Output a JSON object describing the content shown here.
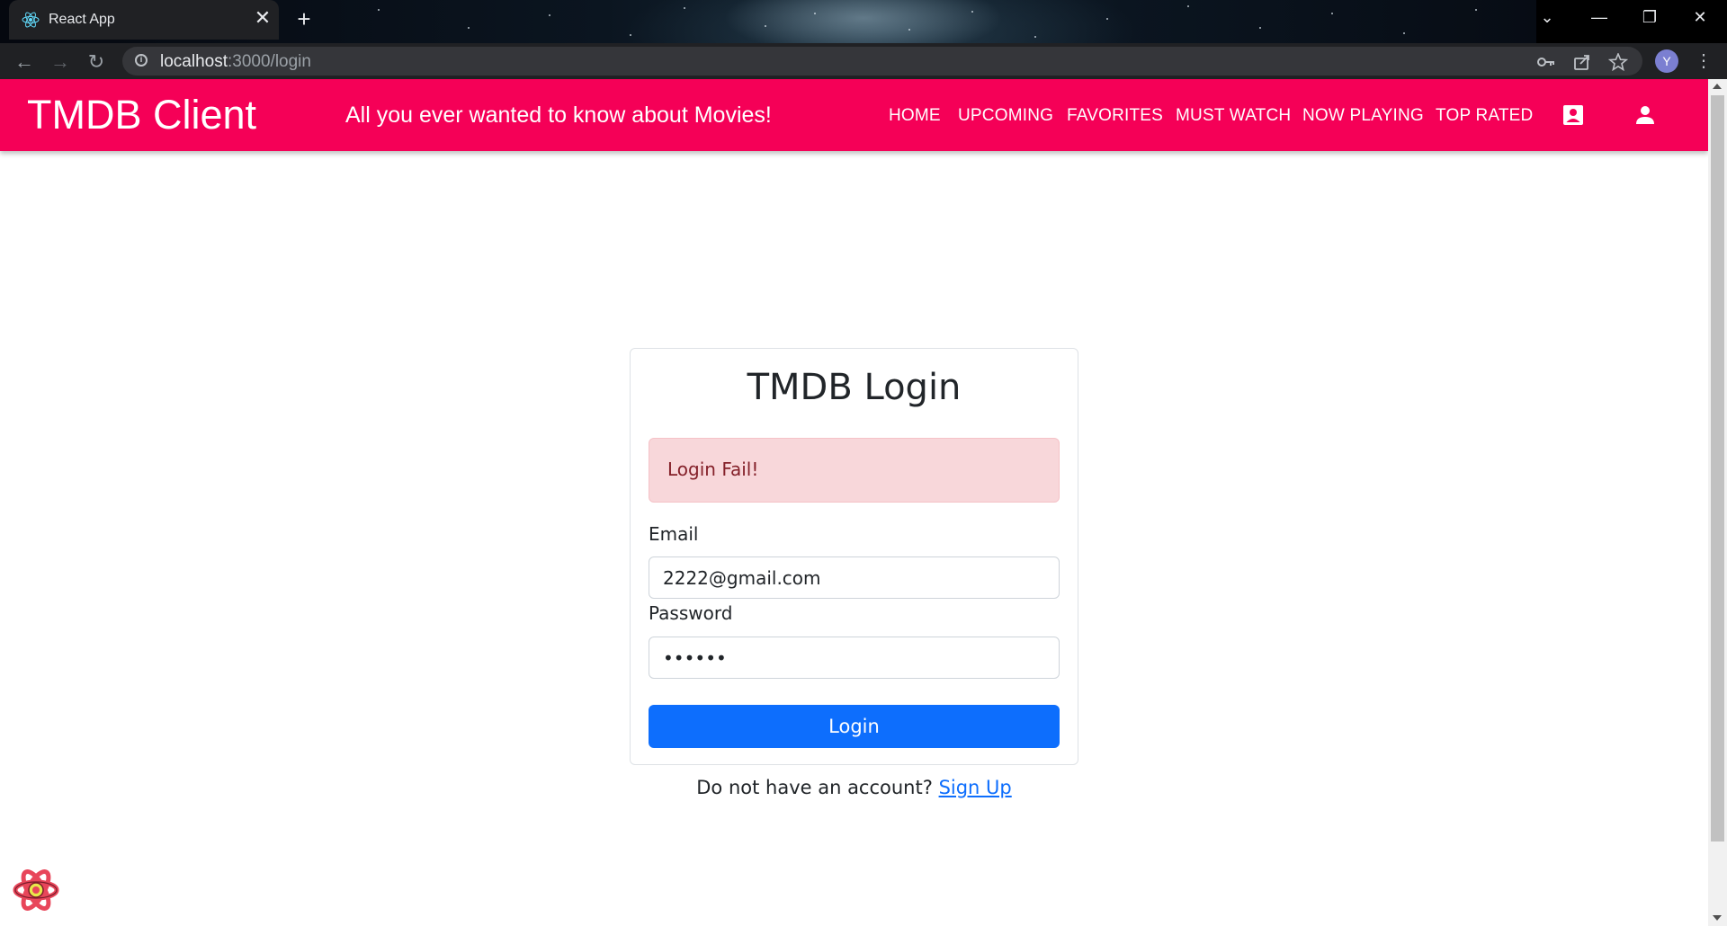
{
  "browser": {
    "tab_title": "React App",
    "tab_close": "✕",
    "new_tab": "+",
    "url_host": "localhost",
    "url_path": ":3000/login",
    "profile_initial": "Y",
    "window_controls": {
      "dropdown": "⌄",
      "minimize": "—",
      "restore": "❐",
      "close": "✕"
    },
    "nav": {
      "back": "←",
      "forward": "→",
      "reload": "↻"
    }
  },
  "appbar": {
    "brand": "TMDB Client",
    "tagline": "All you ever wanted to know about Movies!",
    "nav_items": [
      "HOME",
      "UPCOMING",
      "FAVORITES",
      "MUST WATCH",
      "NOW PLAYING",
      "TOP RATED"
    ]
  },
  "login": {
    "title": "TMDB Login",
    "alert": "Login Fail!",
    "email_label": "Email",
    "email_value": "2222@gmail.com",
    "password_label": "Password",
    "password_value": "••••••",
    "button": "Login",
    "no_account": "Do not have an account?",
    "signup_link": "Sign Up"
  },
  "colors": {
    "appbar": "#f50057",
    "primary": "#0d6efd",
    "alert_bg": "#f8d7da",
    "alert_text": "#842029"
  },
  "icons": [
    "react-icon",
    "info-icon",
    "key-icon",
    "share-icon",
    "star-icon",
    "contact-card-icon",
    "person-icon",
    "react-devtools-icon"
  ]
}
